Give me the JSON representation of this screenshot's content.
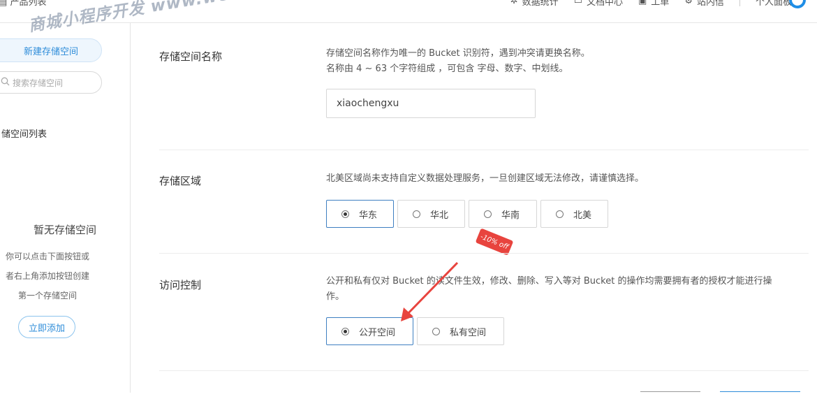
{
  "topbar": {
    "title": "产品列表",
    "nav": [
      "数据统计",
      "文档中心",
      "工单",
      "站内信"
    ],
    "user_label": "个人面板"
  },
  "sidebar": {
    "new_button": "新建存储空间",
    "search_placeholder": "搜索存储空间",
    "list_title": "储空间列表",
    "empty_title": "暂无存储空间",
    "empty_lines": [
      "你可以点击下面按钮或",
      "者右上角添加按钮创建",
      "第一个存储空间"
    ],
    "add_button": "立即添加"
  },
  "watermark": "商城小程序开发 www.weike.cc",
  "form": {
    "name": {
      "label": "存储空间名称",
      "desc1": "存储空间名称作为唯一的 Bucket 识别符，遇到冲突请更换名称。",
      "desc2": "名称由 4 ~ 63 个字符组成 ，可包含 字母、数字、中划线。",
      "value": "xiaochengxu"
    },
    "region": {
      "label": "存储区域",
      "desc": "北美区域尚未支持自定义数据处理服务，一旦创建区域无法修改，请谨慎选择。",
      "options": [
        "华东",
        "华北",
        "华南",
        "北美"
      ],
      "selected": "华东",
      "tag": "-10% off"
    },
    "access": {
      "label": "访问控制",
      "desc1": "公开和私有仅对 Bucket 的读文件生效，修改、删除、写入等对 Bucket 的操作均需要拥有者的授权才能进行操",
      "desc2": "作。",
      "options": [
        "公开空间",
        "私有空间"
      ],
      "selected": "公开空间"
    }
  },
  "colors": {
    "accent": "#2d8cd9",
    "arrow": "#e8443e"
  }
}
